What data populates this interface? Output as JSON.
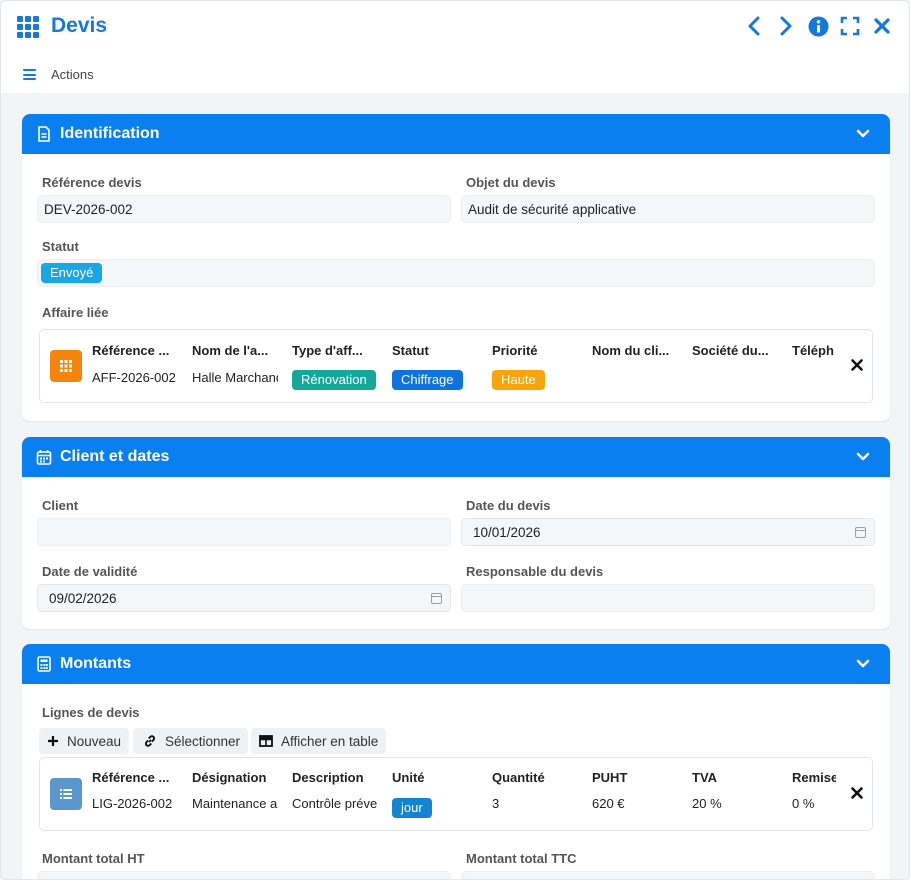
{
  "app": {
    "title": "Devis"
  },
  "toolbar": {
    "actions_label": "Actions"
  },
  "identification": {
    "title": "Identification",
    "reference_label": "Référence devis",
    "reference_value": "DEV-2026-002",
    "objet_label": "Objet du devis",
    "objet_value": "Audit de sécurité applicative",
    "statut_label": "Statut",
    "statut_value": "Envoyé",
    "affaire_label": "Affaire liée",
    "affaire": {
      "headers": [
        "Référence ...",
        "Nom de l'a...",
        "Type d'aff...",
        "Statut",
        "Priorité",
        "Nom du cli...",
        "Société du...",
        "Téléph"
      ],
      "values": {
        "reference": "AFF-2026-002",
        "nom": "Halle Marchande",
        "type": "Rénovation",
        "statut": "Chiffrage",
        "priorite": "Haute"
      }
    }
  },
  "client_dates": {
    "title": "Client et dates",
    "client_label": "Client",
    "client_value": "",
    "date_devis_label": "Date du devis",
    "date_devis_value": "10/01/2026",
    "date_validite_label": "Date de validité",
    "date_validite_value": "09/02/2026",
    "responsable_label": "Responsable du devis",
    "responsable_value": ""
  },
  "montants": {
    "title": "Montants",
    "lignes_label": "Lignes de devis",
    "buttons": {
      "nouveau": "Nouveau",
      "selectionner": "Sélectionner",
      "afficher_table": "Afficher en table"
    },
    "lignes": {
      "headers": [
        "Référence ...",
        "Désignation",
        "Description",
        "Unité",
        "Quantité",
        "PUHT",
        "TVA",
        "Remise"
      ],
      "values": {
        "reference": "LIG-2026-002",
        "designation": "Maintenance applicative",
        "description": "Contrôle préventif",
        "unite": "jour",
        "quantite": "3",
        "puht": "620 €",
        "tva": "20 %",
        "remise": "0 %"
      }
    },
    "total_ht_label": "Montant total HT",
    "total_ttc_label": "Montant total TTC"
  },
  "colors": {
    "accent": "#0a7ff0",
    "badge_envoye": "#18a6e6",
    "badge_renovation": "#14a89b",
    "badge_chiffrage": "#0f73dd",
    "badge_haute": "#f8a50d",
    "badge_jour": "#1483d2",
    "thumb_affaire": "#f5840c",
    "thumb_ligne": "#5a97cc"
  }
}
